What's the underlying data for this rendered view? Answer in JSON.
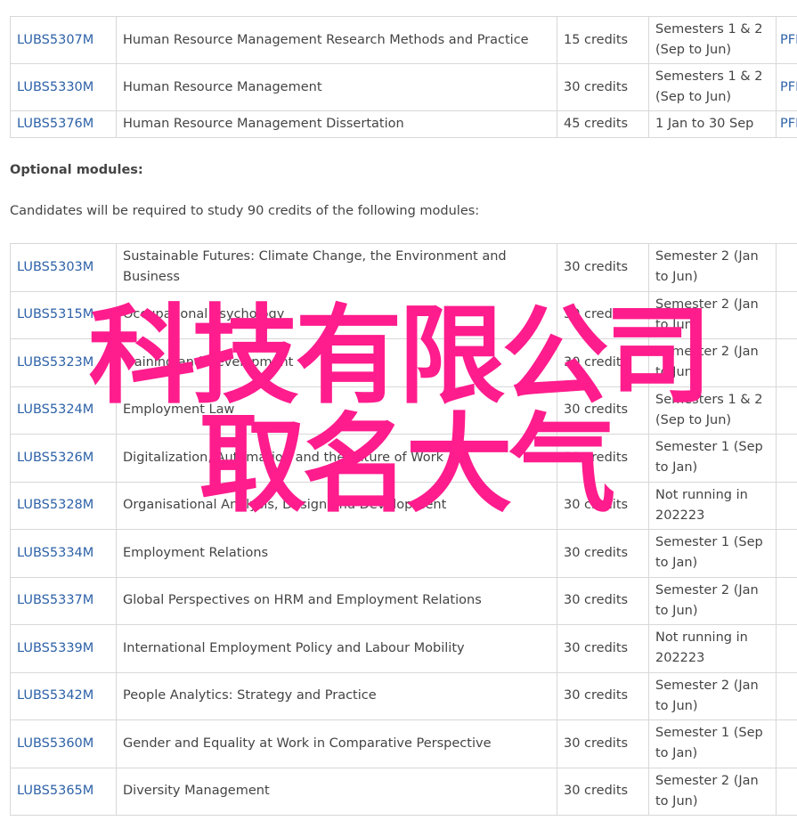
{
  "core_modules": [
    {
      "code": "LUBS5307M",
      "title": "Human Resource Management Research Methods and Practice",
      "credits": "15 credits",
      "semester": [
        "Semesters 1 & 2",
        "(Sep to Jun)"
      ],
      "pfp": "PFP"
    },
    {
      "code": "LUBS5330M",
      "title": "Human Resource Management",
      "credits": "30 credits",
      "semester": [
        "Semesters 1 & 2",
        "(Sep to Jun)"
      ],
      "pfp": "PFP"
    },
    {
      "code": "LUBS5376M",
      "title": "Human Resource Management Dissertation",
      "credits": "45 credits",
      "semester": [
        "1 Jan to 30 Sep"
      ],
      "pfp": "PFP"
    }
  ],
  "optional_heading": "Optional modules:",
  "optional_intro": "Candidates will be required to study 90 credits of the following modules:",
  "optional_modules": [
    {
      "code": "LUBS5303M",
      "title": [
        "Sustainable Futures: Climate Change, the Environment and",
        "Business"
      ],
      "credits": "30 credits",
      "semester": [
        "Semester 2 (Jan",
        "to Jun)"
      ]
    },
    {
      "code": "LUBS5315M",
      "title": [
        "Occupational Psychology"
      ],
      "credits": "30 credits",
      "semester": [
        "Semester 2 (Jan",
        "to Jun)"
      ]
    },
    {
      "code": "LUBS5323M",
      "title": [
        "Training and Development"
      ],
      "credits": "30 credits",
      "semester": [
        "Semester 2 (Jan",
        "to Jun)"
      ]
    },
    {
      "code": "LUBS5324M",
      "title": [
        "Employment Law"
      ],
      "credits": "30 credits",
      "semester": [
        "Semesters 1 & 2",
        "(Sep to Jun)"
      ]
    },
    {
      "code": "LUBS5326M",
      "title": [
        "Digitalization, Automation and the Future of Work"
      ],
      "credits": "30 credits",
      "semester": [
        "Semester 1 (Sep",
        "to Jan)"
      ]
    },
    {
      "code": "LUBS5328M",
      "title": [
        "Organisational Analysis, Design and Development"
      ],
      "credits": "30 credits",
      "semester": [
        "Not running in",
        "202223"
      ]
    },
    {
      "code": "LUBS5334M",
      "title": [
        "Employment Relations"
      ],
      "credits": "30 credits",
      "semester": [
        "Semester 1 (Sep",
        "to Jan)"
      ]
    },
    {
      "code": "LUBS5337M",
      "title": [
        "Global Perspectives on HRM and Employment Relations"
      ],
      "credits": "30 credits",
      "semester": [
        "Semester 2 (Jan",
        "to Jun)"
      ]
    },
    {
      "code": "LUBS5339M",
      "title": [
        "International Employment Policy and Labour Mobility"
      ],
      "credits": "30 credits",
      "semester": [
        "Not running in",
        "202223"
      ]
    },
    {
      "code": "LUBS5342M",
      "title": [
        "People Analytics: Strategy and Practice"
      ],
      "credits": "30 credits",
      "semester": [
        "Semester 2 (Jan",
        "to Jun)"
      ]
    },
    {
      "code": "LUBS5360M",
      "title": [
        "Gender and Equality at Work in Comparative Perspective"
      ],
      "credits": "30 credits",
      "semester": [
        "Semester 1 (Sep",
        "to Jan)"
      ]
    },
    {
      "code": "LUBS5365M",
      "title": [
        "Diversity Management"
      ],
      "credits": "30 credits",
      "semester": [
        "Semester 2 (Jan",
        "to Jun)"
      ]
    }
  ],
  "watermark": {
    "line1": "科技有限公司",
    "line2": "取名大气",
    "color": "#ff1c8d"
  },
  "link_color": "#2e62a8"
}
